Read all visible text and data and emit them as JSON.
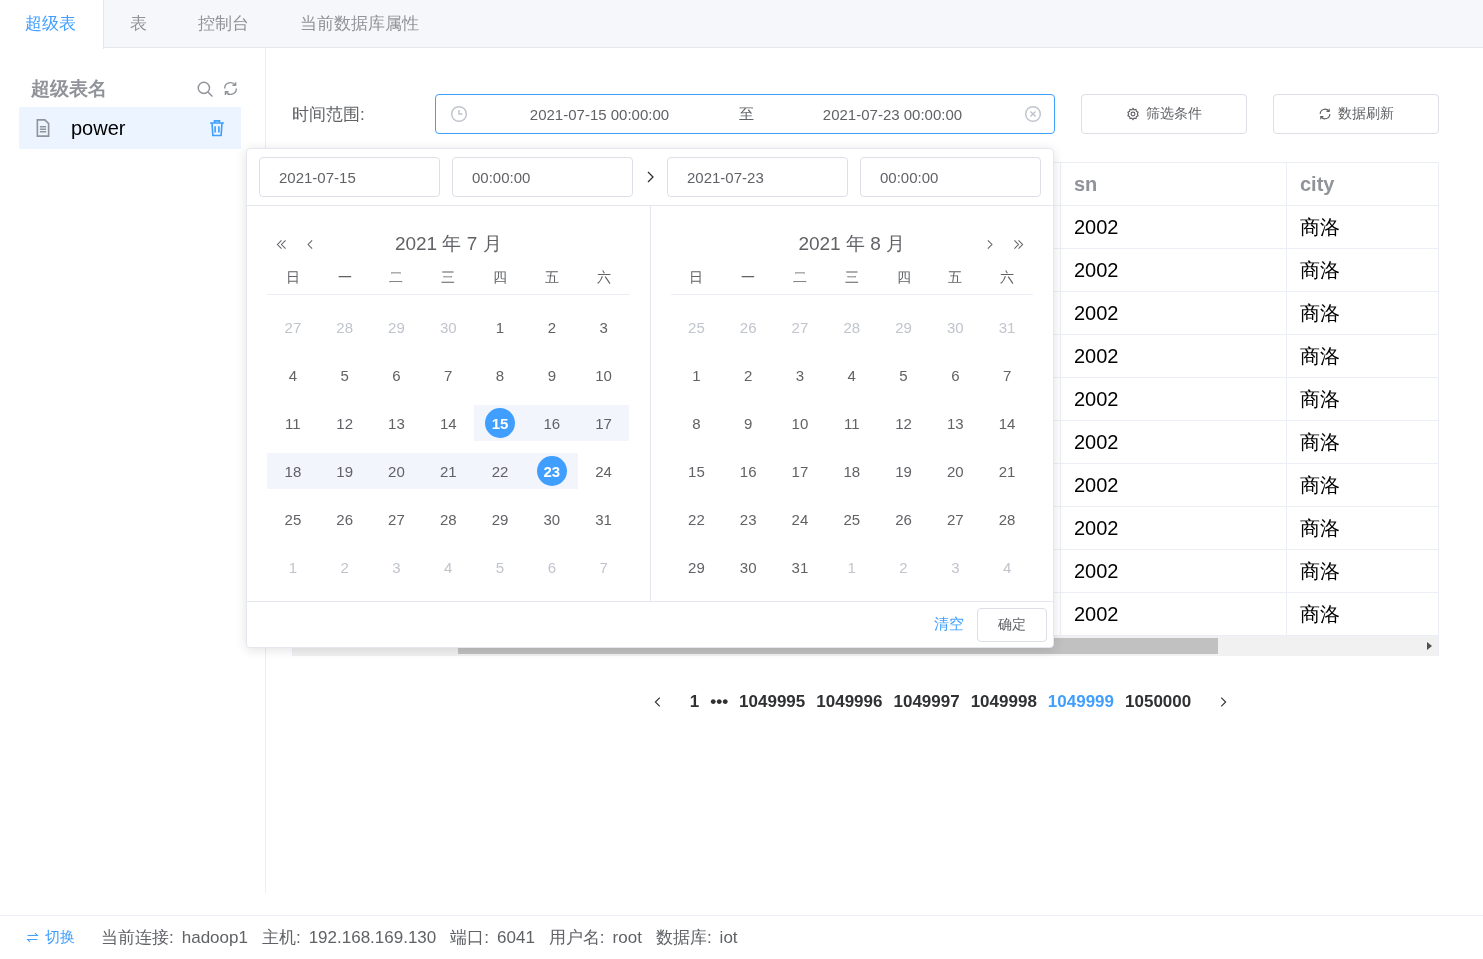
{
  "tabs": [
    {
      "label": "超级表",
      "selected": true
    },
    {
      "label": "表",
      "selected": false
    },
    {
      "label": "控制台",
      "selected": false
    },
    {
      "label": "当前数据库属性",
      "selected": false
    }
  ],
  "sidebar": {
    "title": "超级表名",
    "items": [
      {
        "label": "power",
        "selected": true
      }
    ]
  },
  "filter": {
    "label": "时间范围:",
    "start": "2021-07-15 00:00:00",
    "separator": "至",
    "end": "2021-07-23 00:00:00",
    "focused": true
  },
  "buttons": [
    "筛选条件",
    "数据刷新"
  ],
  "picker": {
    "start_date": "2021-07-15",
    "start_time": "00:00:00",
    "end_date": "2021-07-23",
    "end_time": "00:00:00",
    "months": [
      {
        "title": "2021 年 7 月",
        "weekdays": [
          "日",
          "一",
          "二",
          "三",
          "四",
          "五",
          "六"
        ],
        "weeks": [
          [
            {
              "d": "27",
              "other": true
            },
            {
              "d": "28",
              "other": true
            },
            {
              "d": "29",
              "other": true
            },
            {
              "d": "30",
              "other": true
            },
            {
              "d": "1"
            },
            {
              "d": "2"
            },
            {
              "d": "3"
            }
          ],
          [
            {
              "d": "4"
            },
            {
              "d": "5"
            },
            {
              "d": "6"
            },
            {
              "d": "7"
            },
            {
              "d": "8"
            },
            {
              "d": "9"
            },
            {
              "d": "10"
            }
          ],
          [
            {
              "d": "11"
            },
            {
              "d": "12"
            },
            {
              "d": "13"
            },
            {
              "d": "14"
            },
            {
              "d": "15",
              "selected": true,
              "in_range": true
            },
            {
              "d": "16",
              "in_range": true
            },
            {
              "d": "17",
              "in_range": true
            }
          ],
          [
            {
              "d": "18",
              "in_range": true
            },
            {
              "d": "19",
              "in_range": true
            },
            {
              "d": "20",
              "in_range": true
            },
            {
              "d": "21",
              "in_range": true
            },
            {
              "d": "22",
              "in_range": true
            },
            {
              "d": "23",
              "selected": true,
              "in_range": true
            },
            {
              "d": "24"
            }
          ],
          [
            {
              "d": "25"
            },
            {
              "d": "26"
            },
            {
              "d": "27"
            },
            {
              "d": "28"
            },
            {
              "d": "29"
            },
            {
              "d": "30"
            },
            {
              "d": "31"
            }
          ],
          [
            {
              "d": "1",
              "other": true
            },
            {
              "d": "2",
              "other": true
            },
            {
              "d": "3",
              "other": true
            },
            {
              "d": "4",
              "other": true
            },
            {
              "d": "5",
              "other": true
            },
            {
              "d": "6",
              "other": true
            },
            {
              "d": "7",
              "other": true
            }
          ]
        ]
      },
      {
        "title": "2021 年 8 月",
        "weekdays": [
          "日",
          "一",
          "二",
          "三",
          "四",
          "五",
          "六"
        ],
        "weeks": [
          [
            {
              "d": "25",
              "other": true
            },
            {
              "d": "26",
              "other": true
            },
            {
              "d": "27",
              "other": true
            },
            {
              "d": "28",
              "other": true
            },
            {
              "d": "29",
              "other": true
            },
            {
              "d": "30",
              "other": true
            },
            {
              "d": "31",
              "other": true
            }
          ],
          [
            {
              "d": "1"
            },
            {
              "d": "2"
            },
            {
              "d": "3"
            },
            {
              "d": "4"
            },
            {
              "d": "5"
            },
            {
              "d": "6"
            },
            {
              "d": "7"
            }
          ],
          [
            {
              "d": "8"
            },
            {
              "d": "9"
            },
            {
              "d": "10"
            },
            {
              "d": "11"
            },
            {
              "d": "12"
            },
            {
              "d": "13"
            },
            {
              "d": "14"
            }
          ],
          [
            {
              "d": "15"
            },
            {
              "d": "16"
            },
            {
              "d": "17"
            },
            {
              "d": "18"
            },
            {
              "d": "19"
            },
            {
              "d": "20"
            },
            {
              "d": "21"
            }
          ],
          [
            {
              "d": "22"
            },
            {
              "d": "23"
            },
            {
              "d": "24"
            },
            {
              "d": "25"
            },
            {
              "d": "26"
            },
            {
              "d": "27"
            },
            {
              "d": "28"
            }
          ],
          [
            {
              "d": "29"
            },
            {
              "d": "30"
            },
            {
              "d": "31"
            },
            {
              "d": "1",
              "other": true
            },
            {
              "d": "2",
              "other": true
            },
            {
              "d": "3",
              "other": true
            },
            {
              "d": "4",
              "other": true
            }
          ]
        ]
      }
    ],
    "clear": "清空",
    "confirm": "确定"
  },
  "table": {
    "columns": [
      "sn",
      "city"
    ],
    "rows": [
      [
        "2002",
        "商洛"
      ],
      [
        "2002",
        "商洛"
      ],
      [
        "2002",
        "商洛"
      ],
      [
        "2002",
        "商洛"
      ],
      [
        "2002",
        "商洛"
      ],
      [
        "2002",
        "商洛"
      ],
      [
        "2002",
        "商洛"
      ],
      [
        "2002",
        "商洛"
      ],
      [
        "2002",
        "商洛"
      ],
      [
        "2002",
        "商洛"
      ]
    ]
  },
  "pagination": {
    "pages": [
      {
        "label": "1",
        "selected": false
      },
      {
        "label": "•••",
        "selected": false
      },
      {
        "label": "1049995",
        "selected": false
      },
      {
        "label": "1049996",
        "selected": false
      },
      {
        "label": "1049997",
        "selected": false
      },
      {
        "label": "1049998",
        "selected": false
      },
      {
        "label": "1049999",
        "selected": true
      },
      {
        "label": "1050000",
        "selected": false
      }
    ]
  },
  "status_bar": {
    "switch": "切换",
    "fields": [
      {
        "label": "当前连接:",
        "value": "hadoop1"
      },
      {
        "label": "主机:",
        "value": "192.168.169.130"
      },
      {
        "label": "端口:",
        "value": "6041"
      },
      {
        "label": "用户名:",
        "value": "root"
      },
      {
        "label": "数据库:",
        "value": "iot"
      }
    ]
  }
}
